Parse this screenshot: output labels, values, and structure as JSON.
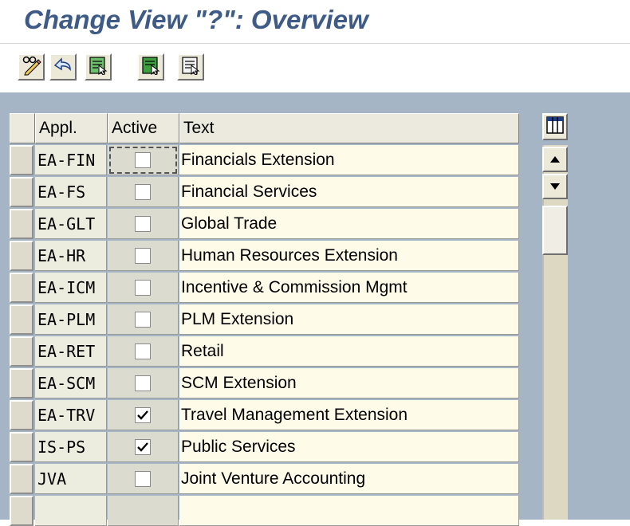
{
  "page": {
    "title": "Change View \"?\": Overview"
  },
  "toolbar": {
    "buttons": [
      {
        "icon": "pencil-glasses-icon"
      },
      {
        "icon": "undo-arrow-icon"
      },
      {
        "icon": "select-all-icon"
      },
      {
        "icon": "select-block-icon"
      },
      {
        "icon": "deselect-all-icon"
      }
    ]
  },
  "table": {
    "columns": [
      "Appl.",
      "Active",
      "Text"
    ],
    "rows": [
      {
        "appl": "EA-FIN",
        "active": false,
        "text": "Financials Extension"
      },
      {
        "appl": "EA-FS",
        "active": false,
        "text": "Financial Services"
      },
      {
        "appl": "EA-GLT",
        "active": false,
        "text": "Global Trade"
      },
      {
        "appl": "EA-HR",
        "active": false,
        "text": "Human Resources Extension"
      },
      {
        "appl": "EA-ICM",
        "active": false,
        "text": "Incentive & Commission Mgmt"
      },
      {
        "appl": "EA-PLM",
        "active": false,
        "text": "PLM Extension"
      },
      {
        "appl": "EA-RET",
        "active": false,
        "text": "Retail"
      },
      {
        "appl": "EA-SCM",
        "active": false,
        "text": "SCM Extension"
      },
      {
        "appl": "EA-TRV",
        "active": true,
        "text": "Travel Management Extension"
      },
      {
        "appl": "IS-PS",
        "active": true,
        "text": "Public Services"
      },
      {
        "appl": "JVA",
        "active": false,
        "text": "Joint Venture Accounting"
      },
      {
        "appl": "",
        "active": null,
        "text": ""
      }
    ]
  },
  "colors": {
    "title": "#3e5a86",
    "background": "#a5b5c6",
    "text_cell": "#fffbe9"
  }
}
